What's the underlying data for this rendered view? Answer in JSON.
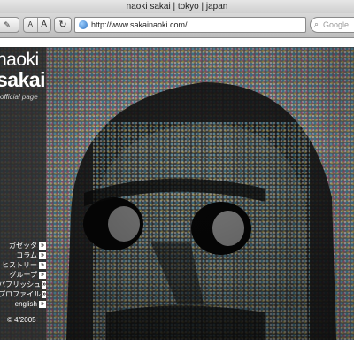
{
  "window": {
    "title": "naoki sakai | tokyo | japan"
  },
  "toolbar": {
    "edit_icon": "pencil-icon",
    "text_smaller": "A",
    "text_larger": "A",
    "reload_icon": "reload-icon",
    "url": "http://www.sakainaoki.com/",
    "search_placeholder": "Google",
    "search_icon": "google-g-icon"
  },
  "site": {
    "name_line1": "naoki",
    "name_line2": "sakai",
    "subtitle": "official page",
    "nav": [
      {
        "label": "ガゼッタ"
      },
      {
        "label": "コラム"
      },
      {
        "label": "ヒストリー"
      },
      {
        "label": "グループ"
      },
      {
        "label": "パブリッシュ"
      },
      {
        "label": "プロファイル"
      },
      {
        "label": "english"
      }
    ],
    "copyright": "© 4/2005",
    "hero_image": "halftone-portrait"
  },
  "colors": {
    "background": "#0b0b0b",
    "sidebar": "#2b2b2b",
    "text": "#ffffff"
  }
}
